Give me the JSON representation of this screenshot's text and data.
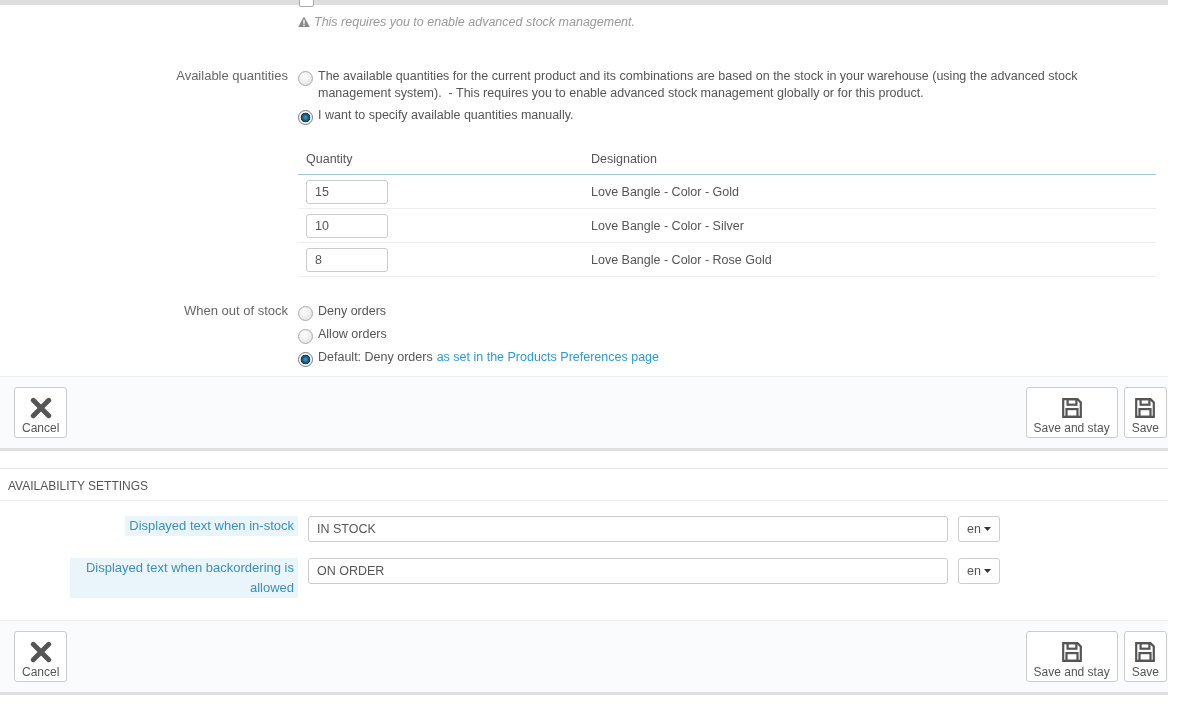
{
  "stock_management": {
    "checked": false,
    "warning": "This requires you to enable advanced stock management."
  },
  "available_quantities": {
    "label": "Available quantities",
    "options": [
      {
        "text": "The available quantities for the current product and its combinations are based on the stock in your warehouse (using the advanced stock management system).  - This requires you to enable advanced stock management globally or for this product.",
        "selected": false
      },
      {
        "text": "I want to specify available quantities manually.",
        "selected": true
      }
    ]
  },
  "quantities_table": {
    "columns": [
      "Quantity",
      "Designation"
    ],
    "rows": [
      {
        "quantity": "15",
        "designation": "Love Bangle - Color - Gold"
      },
      {
        "quantity": "10",
        "designation": "Love Bangle - Color - Silver"
      },
      {
        "quantity": "8",
        "designation": "Love Bangle - Color - Rose Gold"
      }
    ]
  },
  "out_of_stock": {
    "label": "When out of stock",
    "options": [
      {
        "text": "Deny orders",
        "selected": false
      },
      {
        "text": "Allow orders",
        "selected": false
      },
      {
        "text": "Default: Deny orders",
        "link": "as set in the Products Preferences page",
        "selected": true
      }
    ]
  },
  "footer_1": {
    "buttons": [
      {
        "label": "Cancel",
        "kind": "cancel"
      },
      {
        "label": "Save and stay",
        "kind": "save"
      },
      {
        "label": "Save",
        "kind": "save"
      }
    ]
  },
  "availability_settings": {
    "title": "AVAILABILITY SETTINGS",
    "fields": [
      {
        "label": "Displayed text when in-stock",
        "value": "IN STOCK",
        "language": "en"
      },
      {
        "label": "Displayed text when backordering is allowed",
        "value": "ON ORDER",
        "language": "en"
      }
    ]
  },
  "footer_2": {
    "buttons": [
      {
        "label": "Cancel",
        "kind": "cancel"
      },
      {
        "label": "Save and stay",
        "kind": "save"
      },
      {
        "label": "Save",
        "kind": "save"
      }
    ]
  }
}
